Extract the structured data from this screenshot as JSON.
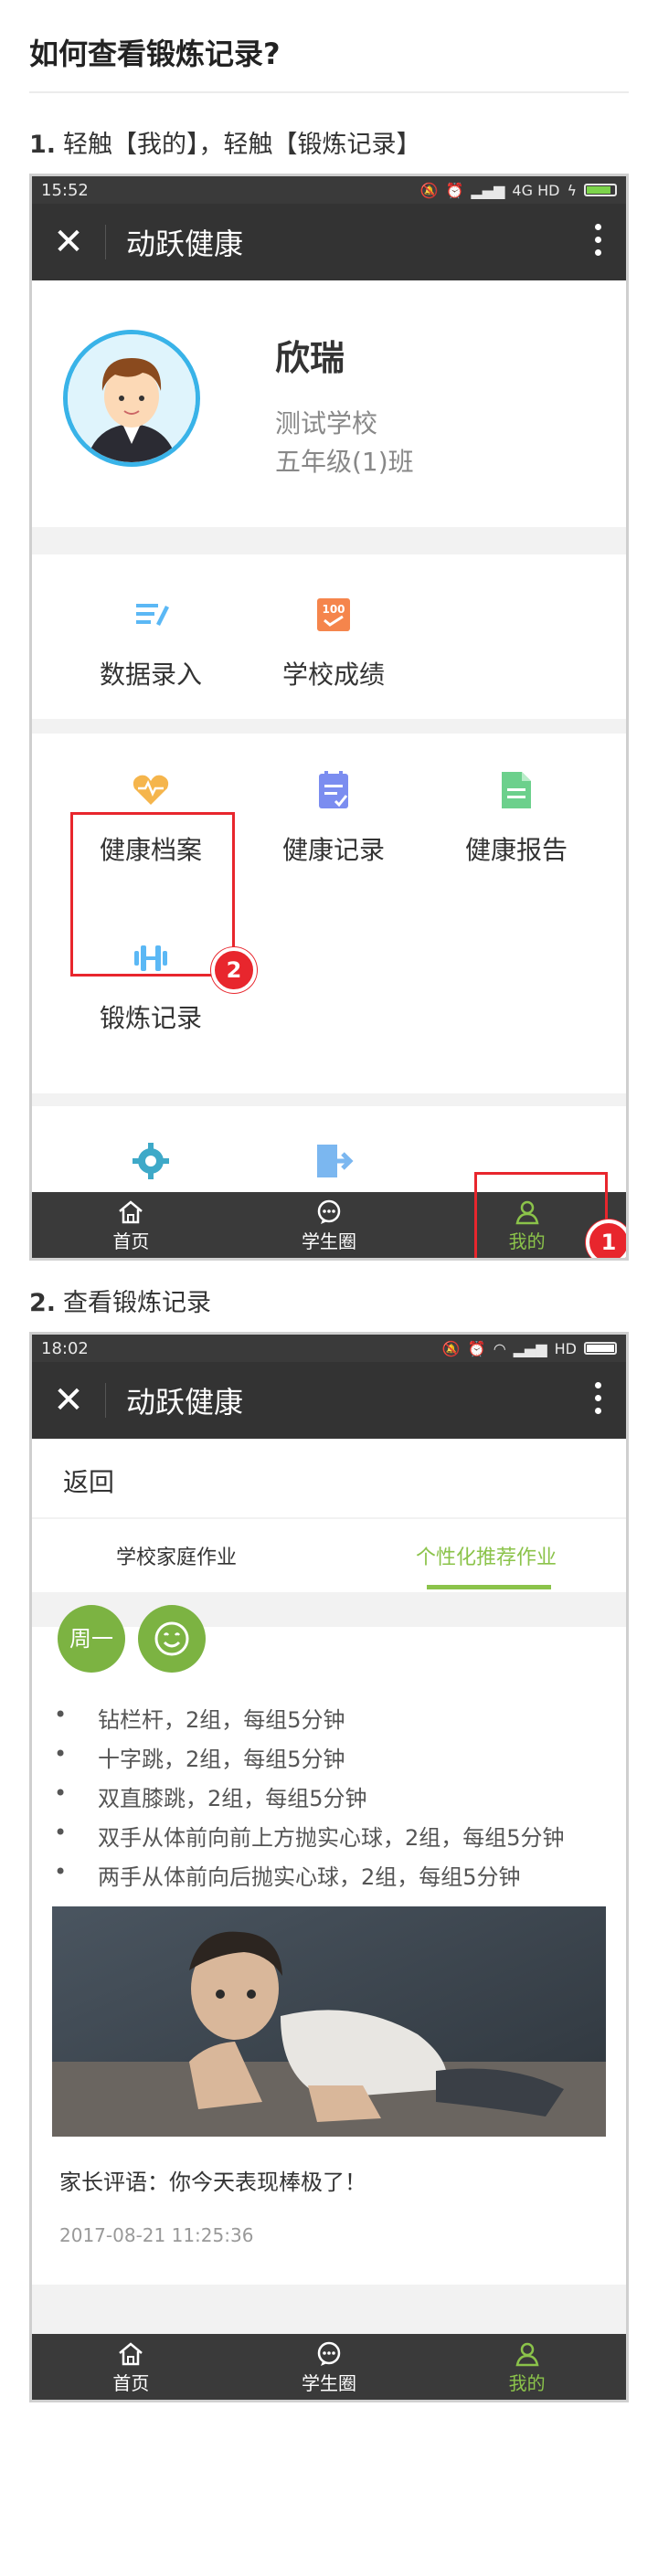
{
  "page_title": "如何查看锻炼记录?",
  "step1": {
    "number": "1.",
    "text": "轻触【我的】，轻触【锻炼记录】"
  },
  "step2": {
    "number": "2.",
    "text": "查看锻炼记录"
  },
  "screen1": {
    "status": {
      "time": "15:52",
      "network": "4G HD"
    },
    "app_title": "动跃健康",
    "profile": {
      "name": "欣瑞",
      "school": "测试学校",
      "class": "五年级(1)班"
    },
    "menu_row1": [
      {
        "label": "数据录入",
        "icon": "data-entry-icon"
      },
      {
        "label": "学校成绩",
        "icon": "school-score-icon"
      }
    ],
    "menu_row2": [
      {
        "label": "健康档案",
        "icon": "health-file-icon"
      },
      {
        "label": "健康记录",
        "icon": "health-record-icon"
      },
      {
        "label": "健康报告",
        "icon": "health-report-icon"
      }
    ],
    "menu_row3": [
      {
        "label": "锻炼记录",
        "icon": "exercise-record-icon"
      }
    ],
    "badges": {
      "one": "1",
      "two": "2"
    },
    "tabs": [
      {
        "label": "首页",
        "icon": "home-icon"
      },
      {
        "label": "学生圈",
        "icon": "chat-icon"
      },
      {
        "label": "我的",
        "icon": "profile-icon"
      }
    ],
    "active_tab": "我的"
  },
  "screen2": {
    "status": {
      "time": "18:02",
      "network": "HD"
    },
    "app_title": "动跃健康",
    "back_label": "返回",
    "tabs": [
      "学校家庭作业",
      "个性化推荐作业"
    ],
    "active_tab": "个性化推荐作业",
    "day_badge": "周一",
    "exercises": [
      "钻栏杆，2组，每组5分钟",
      "十字跳，2组，每组5分钟",
      "双直膝跳，2组，每组5分钟",
      "双手从体前向前上方抛实心球，2组，每组5分钟",
      "两手从体前向后抛实心球，2组，每组5分钟"
    ],
    "comment": "家长评语：你今天表现棒极了！",
    "timestamp": "2017-08-21 11:25:36",
    "bottom_tabs": [
      {
        "label": "首页",
        "icon": "home-icon"
      },
      {
        "label": "学生圈",
        "icon": "chat-icon"
      },
      {
        "label": "我的",
        "icon": "profile-icon"
      }
    ]
  },
  "colors": {
    "accent_green": "#8bc34a",
    "annotation_red": "#e8262d",
    "appbar": "#333333"
  }
}
